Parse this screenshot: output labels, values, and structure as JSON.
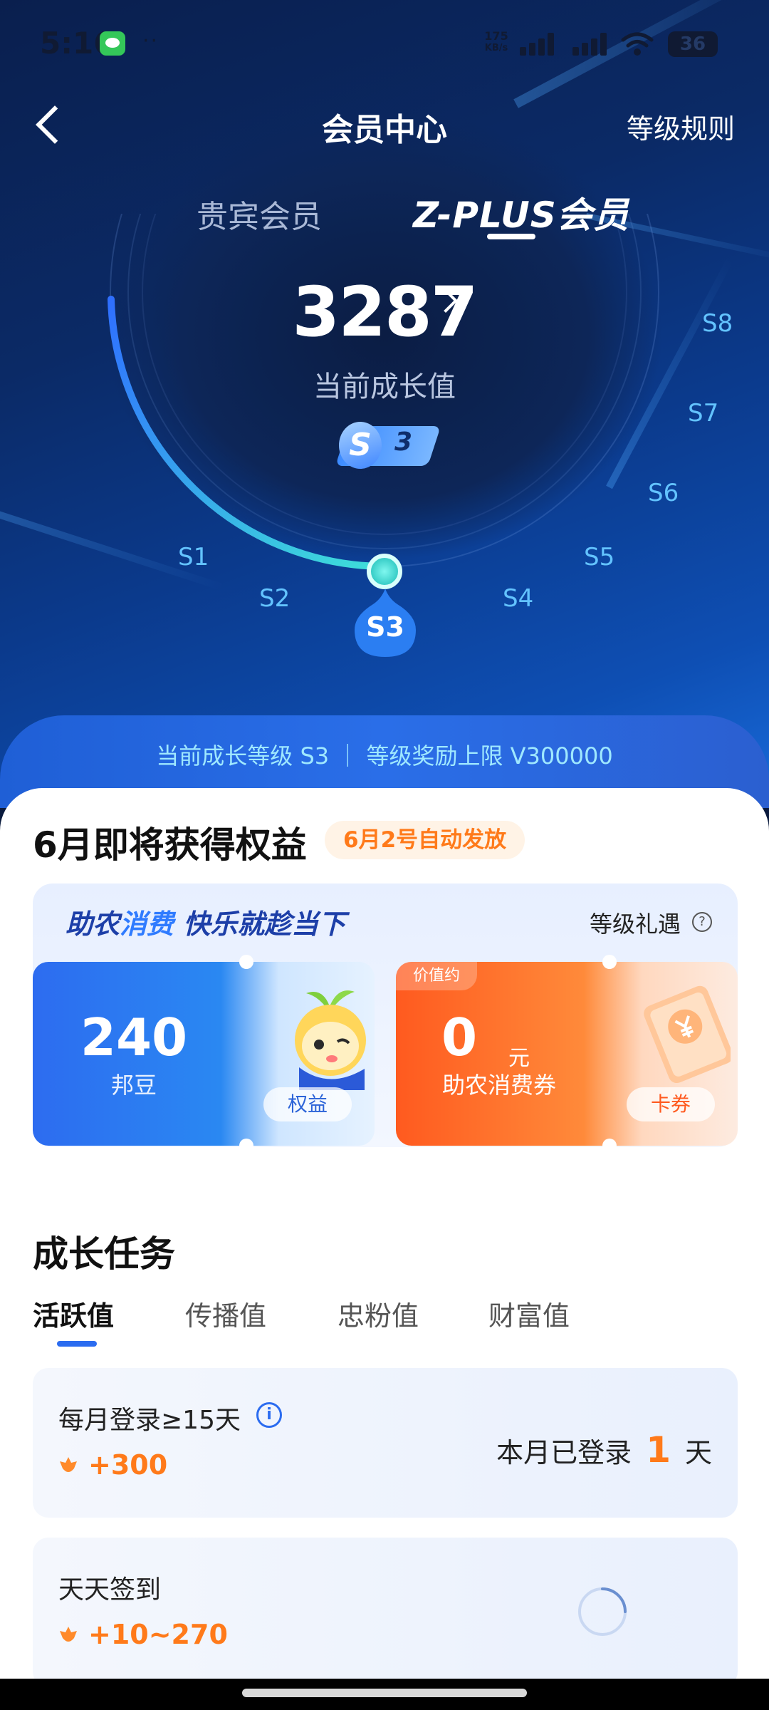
{
  "status_bar": {
    "time": "5:16",
    "dots": "··",
    "speed_value": "175",
    "speed_unit": "KB/s",
    "battery": "36"
  },
  "nav": {
    "title": "会员中心",
    "rules": "等级规则"
  },
  "member_tabs": [
    {
      "label": "贵宾会员",
      "active": false
    },
    {
      "label": "Z-PLUS会员",
      "active": true
    }
  ],
  "growth": {
    "value": "3287",
    "label": "当前成长值",
    "badge_letter": "S",
    "badge_level": "3"
  },
  "levels": [
    "S1",
    "S2",
    "S3",
    "S4",
    "S5",
    "S6",
    "S7",
    "S8"
  ],
  "current_level_pin": "S3",
  "info_strip": "当前成长等级 S3 ｜ 等级奖励上限 V300000",
  "rights": {
    "title": "6月即将获得权益",
    "tag": "6月2号自动发放",
    "slogan_part1": "助农",
    "slogan_highlight": "消费",
    "slogan_part2": " 快乐就趁当下",
    "level_gift": "等级礼遇",
    "help": "?",
    "beans_value": "240",
    "beans_unit": "邦豆",
    "beans_button": "权益",
    "voucher_tag": "价值约",
    "voucher_value": "0",
    "voucher_currency": "元",
    "voucher_label": "助农消费券",
    "voucher_button": "卡券"
  },
  "tasks": {
    "title": "成长任务",
    "tabs": [
      {
        "label": "活跃值",
        "active": true
      },
      {
        "label": "传播值",
        "active": false
      },
      {
        "label": "忠粉值",
        "active": false
      },
      {
        "label": "财富值",
        "active": false
      }
    ],
    "items": [
      {
        "name": "每月登录≥15天",
        "reward": "+300",
        "status_prefix": "本月已登录",
        "status_value": "1",
        "status_suffix": "天"
      },
      {
        "name": "天天签到",
        "reward": "+10~270"
      }
    ]
  },
  "colors": {
    "accent_orange": "#ff7a1a",
    "accent_blue": "#2b6cf0",
    "gauge_cyan": "#3ee0d8",
    "level_label": "#63c3ff"
  },
  "icons": [
    "back-arrow-icon",
    "chevron-right-icon",
    "help-circle-icon",
    "info-circle-icon",
    "flower-icon",
    "loading-spinner-icon"
  ]
}
